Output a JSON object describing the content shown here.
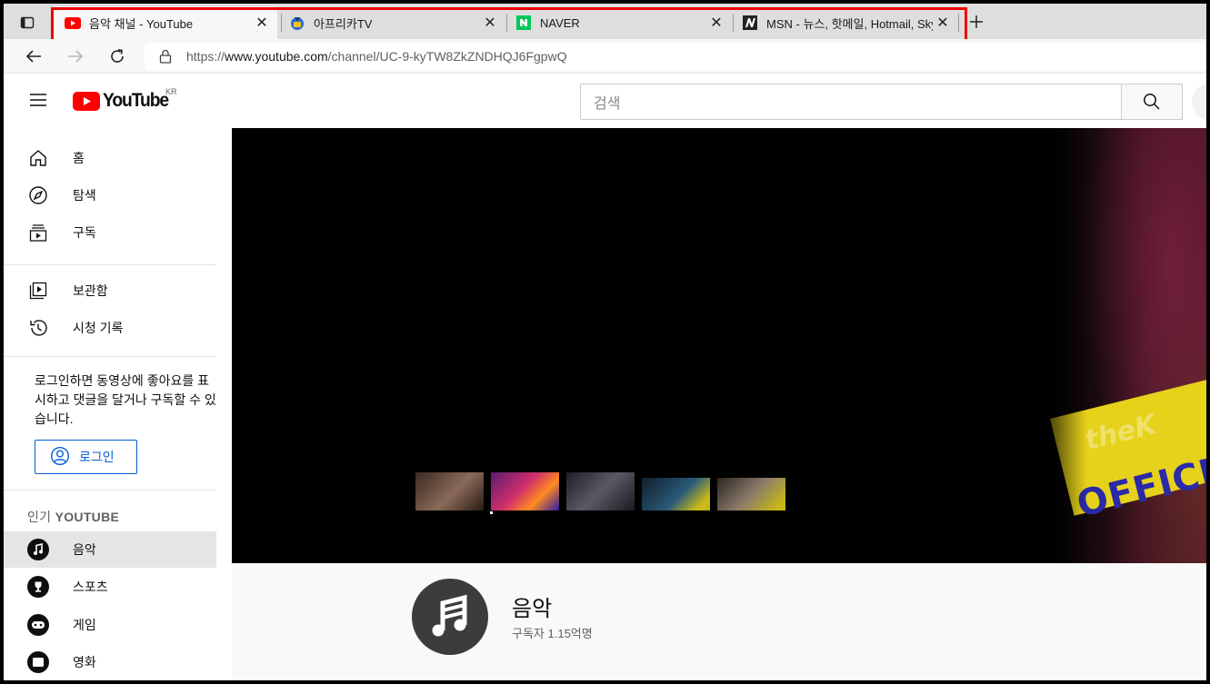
{
  "tabs": [
    {
      "title": "음악 채널 - YouTube",
      "favicon": "youtube-favicon",
      "active": true
    },
    {
      "title": "아프리카TV",
      "favicon": "afreecatv-favicon",
      "active": false
    },
    {
      "title": "NAVER",
      "favicon": "naver-favicon",
      "active": false
    },
    {
      "title": "MSN - 뉴스, 핫메일, Hotmail, Skype",
      "favicon": "msn-favicon",
      "active": false
    }
  ],
  "address": {
    "scheme": "https://",
    "host": "www.youtube.com",
    "path": "/channel/UC-9-kyTW8ZkZNDHQJ6FgpwQ"
  },
  "header": {
    "logo_text": "YouTube",
    "country_code": "KR",
    "search_placeholder": "검색"
  },
  "sidebar": {
    "main_items": [
      {
        "label": "홈",
        "icon": "home-icon"
      },
      {
        "label": "탐색",
        "icon": "compass-icon"
      },
      {
        "label": "구독",
        "icon": "subscriptions-icon"
      }
    ],
    "library_items": [
      {
        "label": "보관함",
        "icon": "library-icon"
      },
      {
        "label": "시청 기록",
        "icon": "history-icon"
      }
    ],
    "login_message": "로그인하면 동영상에 좋아요를 표시하고 댓글을 달거나 구독할 수 있습니다.",
    "login_button": "로그인",
    "popular_heading_prefix": "인기",
    "popular_heading": "YOUTUBE",
    "popular_items": [
      {
        "label": "음악",
        "icon": "music-icon",
        "active": true
      },
      {
        "label": "스포츠",
        "icon": "trophy-icon",
        "active": false
      },
      {
        "label": "게임",
        "icon": "gamepad-icon",
        "active": false
      },
      {
        "label": "영화",
        "icon": "movie-icon",
        "active": false
      }
    ]
  },
  "banner": {
    "brand_text": "theK",
    "brand_text_2": "OFFICIA"
  },
  "channel": {
    "name": "음악",
    "subscribers": "구독자 1.15억명"
  },
  "colors": {
    "youtube_red": "#ff0000",
    "link_blue": "#065fd4",
    "highlight_red": "#ee0000",
    "naver_green": "#03c75a"
  }
}
